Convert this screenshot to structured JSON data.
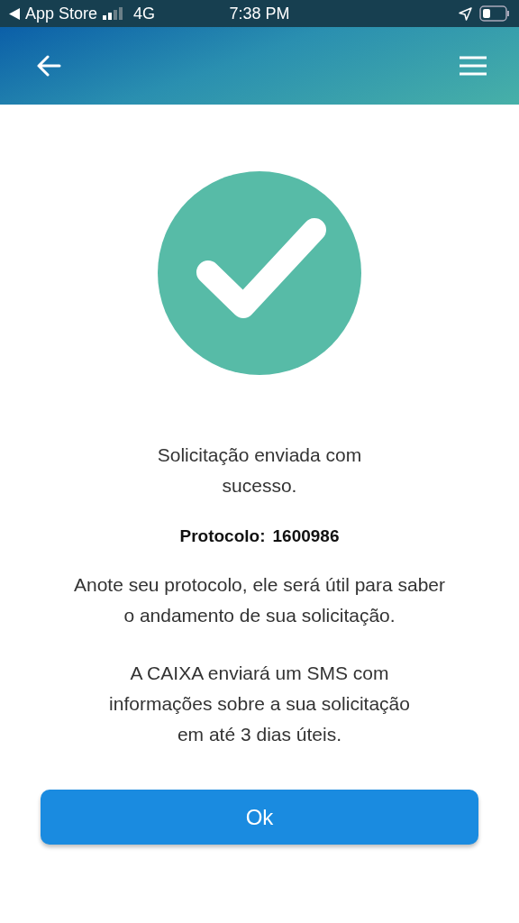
{
  "status_bar": {
    "back_label": "App Store",
    "network": "4G",
    "time": "7:38 PM"
  },
  "success": {
    "title": "Solicitação enviada com sucesso.",
    "protocol_label": "Protocolo:",
    "protocol_number": "1600986",
    "note": "Anote seu protocolo, ele será útil para saber o andamento de sua solicitação.",
    "sms_info": "A CAIXA enviará um SMS com informações sobre a sua solicitação em até 3 dias úteis."
  },
  "button": {
    "label": "Ok"
  }
}
